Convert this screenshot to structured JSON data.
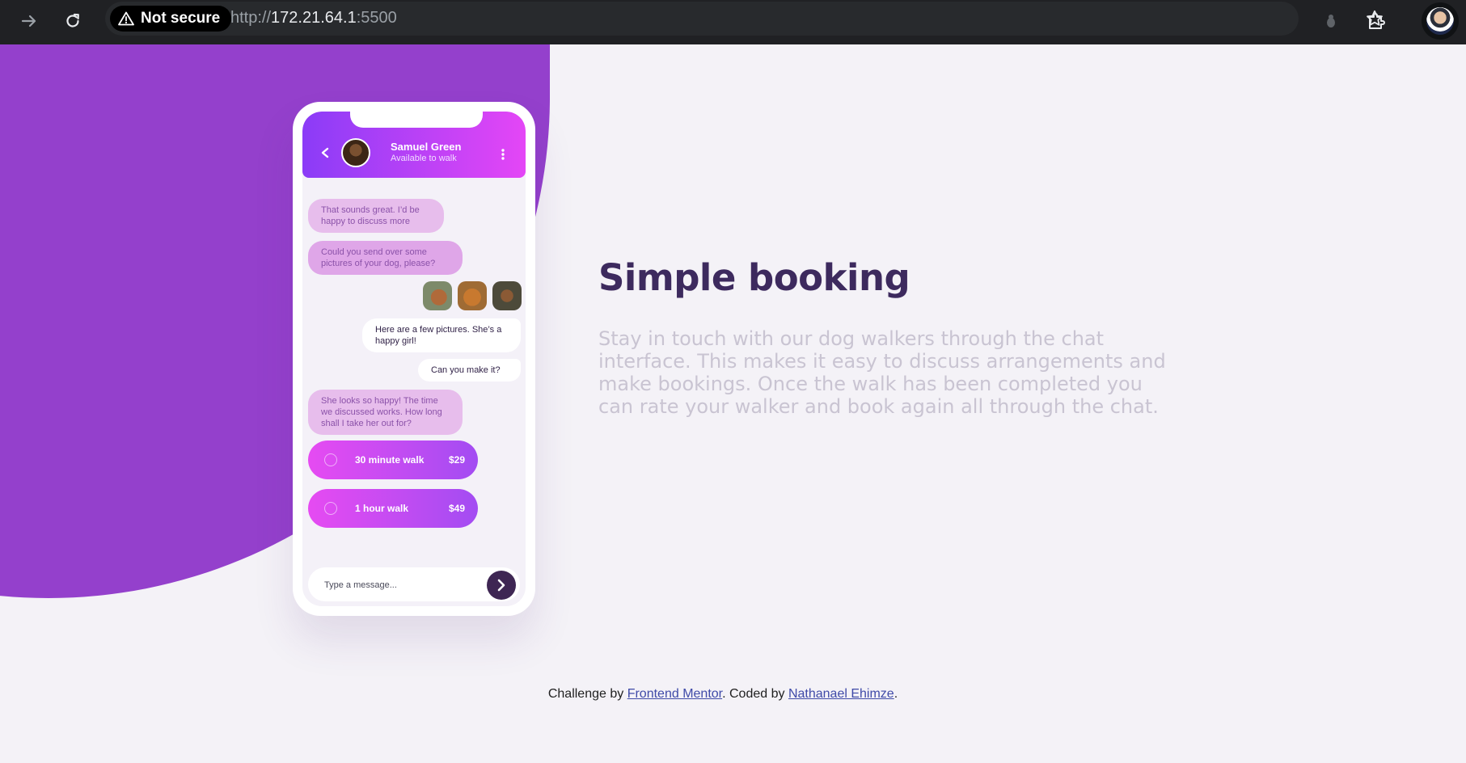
{
  "browser": {
    "security_label": "Not secure",
    "url_scheme": "http://",
    "url_host": "172.21.64.1",
    "url_port": ":5500"
  },
  "chat": {
    "contact_name": "Samuel Green",
    "contact_status": "Available to walk",
    "messages": [
      "That sounds great. I’d be happy to discuss more",
      "Could you send over some pictures of your dog, please?",
      "Here are a few pictures. She’s a happy girl!",
      "Can you make it?",
      "She looks so happy! The time we discussed works. How long shall I take her out for?"
    ],
    "options": [
      {
        "label": "30 minute walk",
        "price": "$29"
      },
      {
        "label": "1 hour walk",
        "price": "$49"
      }
    ],
    "input_placeholder": "Type a message..."
  },
  "content": {
    "title": "Simple booking",
    "description": "Stay in touch with our dog walkers through the chat interface. This makes it easy to discuss arrangements and make bookings. Once the walk has been completed you can rate your walker and book again all through the chat."
  },
  "footer": {
    "prefix": "Challenge by",
    "link1": "Frontend Mentor",
    "middle": ". Coded by",
    "link2": "Nathanael Ehimze",
    "suffix": "."
  },
  "colors": {
    "accent_purple": "#9440cc",
    "header_gradient_start": "#8b3cf7",
    "header_gradient_end": "#e446f6",
    "heading": "#3d2a5e"
  }
}
